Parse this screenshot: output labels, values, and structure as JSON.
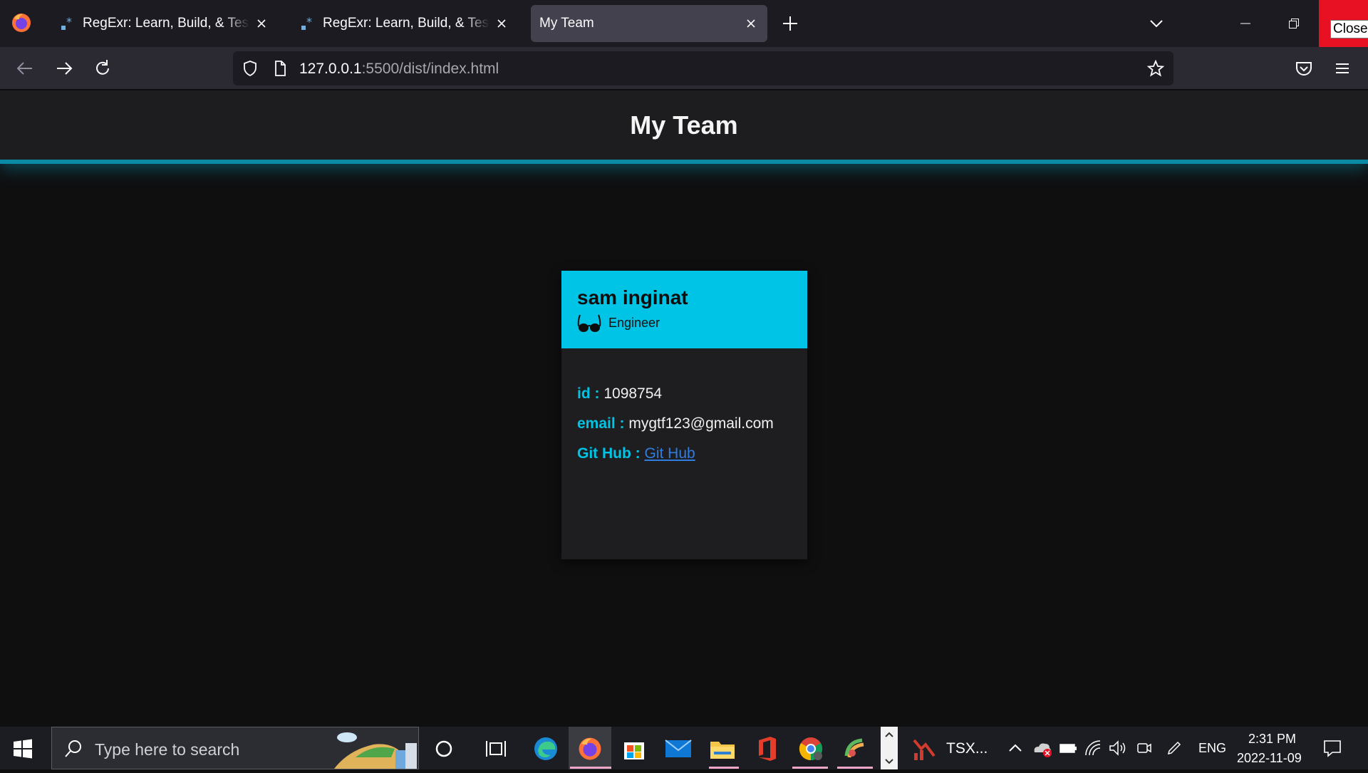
{
  "browser": {
    "tabs": [
      {
        "label": "RegExr: Learn, Build, & Test RegEx",
        "active": false
      },
      {
        "label": "RegExr: Learn, Build, & Test RegEx",
        "active": false
      },
      {
        "label": "My Team",
        "active": true
      }
    ],
    "close_tooltip": "Close",
    "url_host": "127.0.0.1",
    "url_path": ":5500/dist/index.html"
  },
  "page": {
    "title": "My Team",
    "card": {
      "name": "sam inginat",
      "role": "Engineer",
      "role_icon": "glasses-icon",
      "id_label": "id :",
      "id_value": "1098754",
      "email_label": "email :",
      "email_value": "mygtf123@gmail.com",
      "github_label": "Git Hub :",
      "github_link": "Git Hub"
    },
    "accent_color": "#00c4e6"
  },
  "taskbar": {
    "search_placeholder": "Type here to search",
    "pinned_app_label": "TSX...",
    "language": "ENG",
    "time": "2:31 PM",
    "date": "2022-11-09"
  }
}
